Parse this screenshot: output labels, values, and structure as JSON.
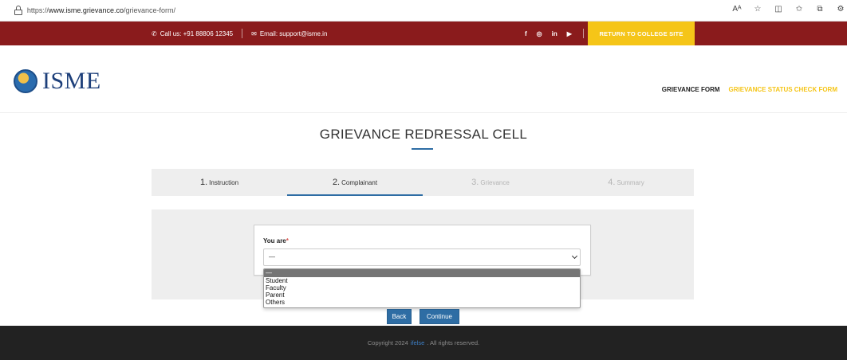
{
  "browser": {
    "url_prefix": "https://",
    "url_host": "www.isme.grievance.co",
    "url_path": "/grievance-form/",
    "icons": [
      "read-aloud-icon",
      "favorite-star-icon",
      "split-screen-icon",
      "favorites-icon",
      "collections-icon",
      "extensions-icon"
    ]
  },
  "topbar": {
    "phone": "Call us: +91 88806 12345",
    "email": "Email: support@isme.in",
    "social_icons": [
      "facebook-icon",
      "instagram-icon",
      "linkedin-icon",
      "youtube-icon"
    ],
    "social_glyphs": [
      "f",
      "◎",
      "in",
      "▶"
    ],
    "return_label": "RETURN TO COLLEGE SITE",
    "bg_color": "#8a1b1c",
    "accent_color": "#f5c518"
  },
  "header": {
    "logo_text": "ISME",
    "nav": {
      "grievance_form": "GRIEVANCE FORM",
      "status_check": "GRIEVANCE STATUS CHECK FORM"
    }
  },
  "page": {
    "title": "GRIEVANCE REDRESSAL CELL"
  },
  "steps": [
    {
      "num": "1.",
      "label": "Instruction"
    },
    {
      "num": "2.",
      "label": "Complainant"
    },
    {
      "num": "3.",
      "label": "Grievance"
    },
    {
      "num": "4.",
      "label": "Summary"
    }
  ],
  "form": {
    "field_label": "You are",
    "required_mark": "*",
    "selected_value": "—",
    "options": [
      "—",
      "Student",
      "Faculty",
      "Parent",
      "Others"
    ]
  },
  "buttons": {
    "back": "Back",
    "continue": "Continue"
  },
  "footer": {
    "prefix": "Copyright 2024",
    "brand": "ifelse",
    "suffix": ". All rights reserved."
  }
}
